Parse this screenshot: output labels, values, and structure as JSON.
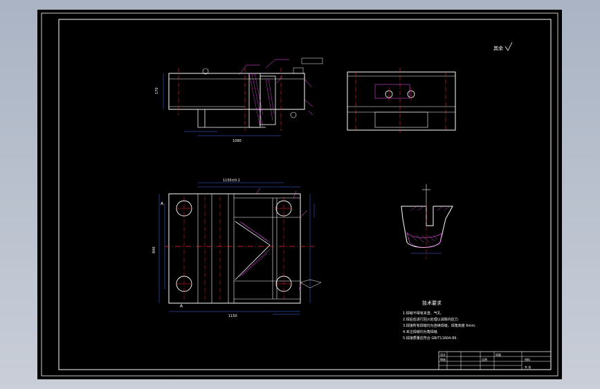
{
  "drawing": {
    "roughness_note": "其余",
    "tech_title": "技术要求",
    "tech_notes": [
      "1.焊缝不得有夹渣、气孔.",
      "2.焊后应进行回火处理以消除内应力.",
      "3.焊接所有焊缝均为连续焊缝，焊角高度 6mm.",
      "4.未注焊缝均为角焊缝.",
      "5.焊接质量应符合 GB/T11604-89."
    ],
    "top_view_dim": "1150±0.1",
    "front_view_dim_left": "170",
    "front_view_dim_bottom": "1080",
    "plan_dim_bottom": "1150",
    "plan_dim_right": "840",
    "section_label": "A",
    "title_block": {
      "label_design": "设计",
      "label_check": "审核",
      "label_scale": "比例",
      "label_material": "材料",
      "part_name": "机架",
      "sheet": "共  张"
    }
  },
  "colors": {
    "sheet": "#000000",
    "line": "#ffffff",
    "center": "#ff2a2a",
    "dimension": "#4a6bff",
    "hatch": "#ff55ff",
    "border": "#ffffff"
  }
}
